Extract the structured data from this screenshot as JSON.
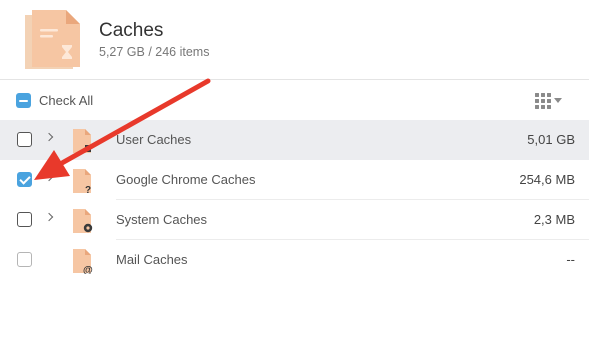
{
  "header": {
    "title": "Caches",
    "subtitle": "5,27 GB / 246 items",
    "icon": "document-hourglass-icon"
  },
  "toolbar": {
    "check_all_label": "Check All",
    "check_all_state": "mixed",
    "view_icon": "grid-view-icon"
  },
  "rows": [
    {
      "name": "User Caches",
      "size": "5,01 GB",
      "checked": false,
      "expandable": true,
      "selected": true,
      "icon_badge": "none"
    },
    {
      "name": "Google Chrome Caches",
      "size": "254,6 MB",
      "checked": true,
      "expandable": true,
      "selected": false,
      "icon_badge": "question-mark"
    },
    {
      "name": "System Caches",
      "size": "2,3 MB",
      "checked": false,
      "expandable": true,
      "selected": false,
      "icon_badge": "gear"
    },
    {
      "name": "Mail Caches",
      "size": "--",
      "checked": false,
      "expandable": false,
      "selected": false,
      "icon_badge": "at-sign"
    }
  ],
  "colors": {
    "accent": "#4aa3df",
    "annotation_arrow": "#e8392b",
    "selected_row": "#ecedf0",
    "file_icon": "#f5c8a6"
  }
}
